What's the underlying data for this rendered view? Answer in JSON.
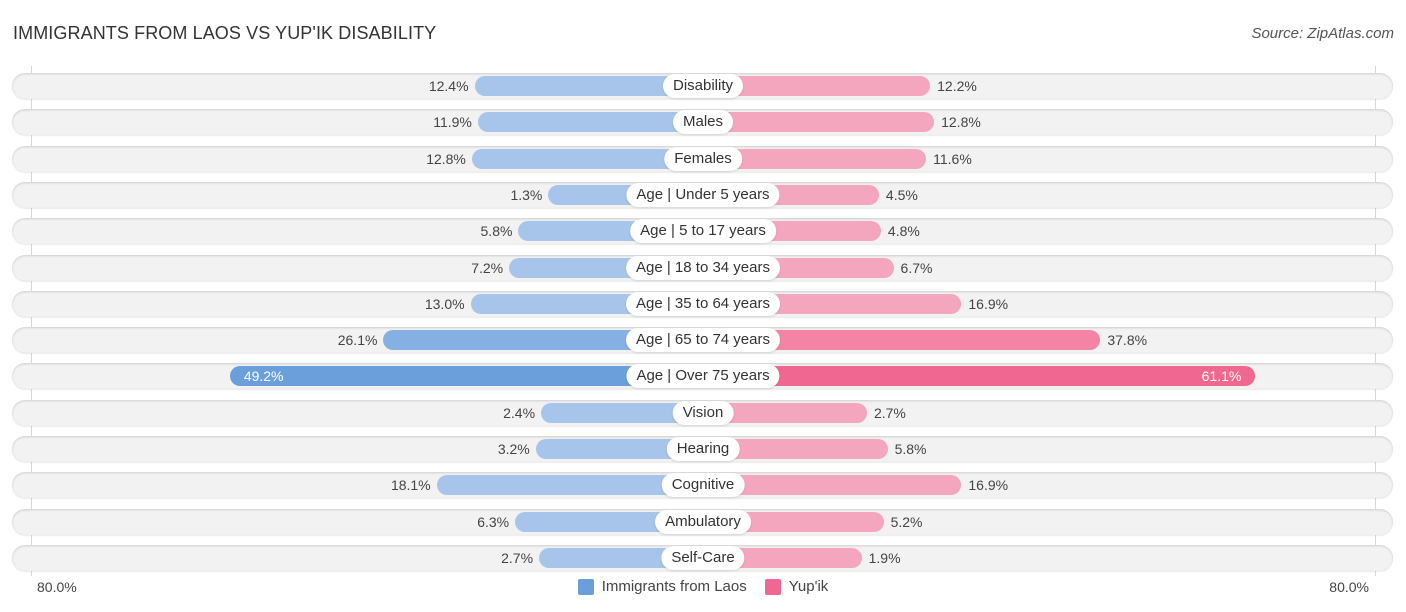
{
  "title": "IMMIGRANTS FROM LAOS VS YUP'IK DISABILITY",
  "source": "Source: ZipAtlas.com",
  "colors": {
    "left": "#6a9fdc",
    "left_light": "#a7c5ea",
    "right": "#f06892",
    "right_light": "#f5a6bf"
  },
  "chart_data": {
    "type": "bar",
    "orientation": "diverging-horizontal",
    "title": "IMMIGRANTS FROM LAOS VS YUP'IK DISABILITY",
    "categories": [
      "Disability",
      "Males",
      "Females",
      "Age | Under 5 years",
      "Age | 5 to 17 years",
      "Age | 18 to 34 years",
      "Age | 35 to 64 years",
      "Age | 65 to 74 years",
      "Age | Over 75 years",
      "Vision",
      "Hearing",
      "Cognitive",
      "Ambulatory",
      "Self-Care"
    ],
    "series": [
      {
        "name": "Immigrants from Laos",
        "side": "left",
        "values": [
          12.4,
          11.9,
          12.8,
          1.3,
          5.8,
          7.2,
          13.0,
          26.1,
          49.2,
          2.4,
          3.2,
          18.1,
          6.3,
          2.7
        ],
        "labels": [
          "12.4%",
          "11.9%",
          "12.8%",
          "1.3%",
          "5.8%",
          "7.2%",
          "13.0%",
          "26.1%",
          "49.2%",
          "2.4%",
          "3.2%",
          "18.1%",
          "6.3%",
          "2.7%"
        ]
      },
      {
        "name": "Yup'ik",
        "side": "right",
        "values": [
          12.2,
          12.8,
          11.6,
          4.5,
          4.8,
          6.7,
          16.9,
          37.8,
          61.1,
          2.7,
          5.8,
          16.9,
          5.2,
          1.9
        ],
        "labels": [
          "12.2%",
          "12.8%",
          "11.6%",
          "4.5%",
          "4.8%",
          "6.7%",
          "16.9%",
          "37.8%",
          "61.1%",
          "2.7%",
          "5.8%",
          "16.9%",
          "5.2%",
          "1.9%"
        ]
      }
    ],
    "axis": {
      "left_label": "80.0%",
      "right_label": "80.0%",
      "max": 80.0
    },
    "legend": {
      "position": "bottom-center",
      "entries": [
        "Immigrants from Laos",
        "Yup'ik"
      ]
    }
  }
}
